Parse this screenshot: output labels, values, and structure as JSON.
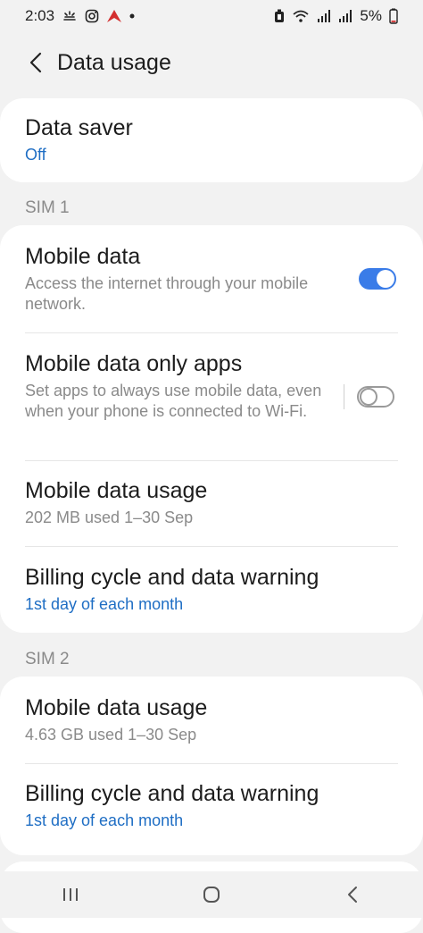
{
  "status_bar": {
    "time": "2:03",
    "battery": "5%",
    "left_icons": [
      "weather-icon",
      "instagram-icon",
      "app-icon",
      "dot-icon"
    ],
    "right_icons": [
      "alarm-icon",
      "wifi-icon",
      "signal-icon",
      "signal-icon-2",
      "battery-icon"
    ]
  },
  "header": {
    "title": "Data usage"
  },
  "data_saver": {
    "title": "Data saver",
    "status": "Off"
  },
  "sim1": {
    "label": "SIM 1",
    "mobile_data": {
      "title": "Mobile data",
      "description": "Access the internet through your mobile network.",
      "enabled": true
    },
    "mobile_data_only_apps": {
      "title": "Mobile data only apps",
      "description": "Set apps to always use mobile data, even when your phone is connected to Wi-Fi.",
      "enabled": false
    },
    "mobile_data_usage": {
      "title": "Mobile data usage",
      "value": "202 MB used 1–30 Sep"
    },
    "billing_cycle": {
      "title": "Billing cycle and data warning",
      "value": "1st day of each month"
    }
  },
  "sim2": {
    "label": "SIM 2",
    "mobile_data_usage": {
      "title": "Mobile data usage",
      "value": "4.63 GB used 1–30 Sep"
    },
    "billing_cycle": {
      "title": "Billing cycle and data warning",
      "value": "1st day of each month"
    }
  },
  "colors": {
    "accent": "#1f6ec4",
    "toggle_on": "#3a7ce8",
    "background": "#f2f2f2",
    "card": "#ffffff"
  },
  "nav_bar": {
    "buttons": [
      "recents-icon",
      "home-icon",
      "back-icon"
    ]
  }
}
